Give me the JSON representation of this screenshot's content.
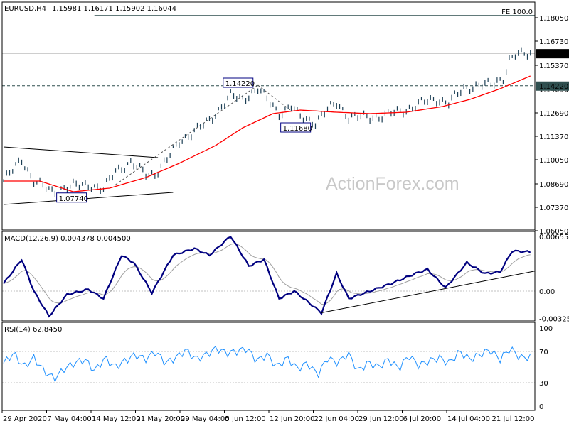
{
  "chart_data": {
    "type": "line",
    "title": "EURUSD,H4",
    "ohlc_header": "1.15981 1.16171 1.15902 1.16044",
    "watermark": "ActionForex.com",
    "price_panel": {
      "ylim": [
        1.0605,
        1.1905
      ],
      "ticks": [
        "1.18050",
        "1.16730",
        "1.15370",
        "1.14030",
        "1.12690",
        "1.11370",
        "1.10050",
        "1.08690",
        "1.07370",
        "1.06050"
      ],
      "tick_values": [
        1.1805,
        1.1673,
        1.1537,
        1.1403,
        1.1269,
        1.1137,
        1.1005,
        1.0869,
        1.0737,
        1.0605
      ],
      "bar_count": 175,
      "typical_bar_range": 0.003,
      "close_keypoints": [
        [
          0,
          1.0885
        ],
        [
          6,
          1.1005
        ],
        [
          10,
          1.0885
        ],
        [
          16,
          1.0825
        ],
        [
          23,
          1.0857
        ],
        [
          28,
          1.0865
        ],
        [
          33,
          1.0833
        ],
        [
          37,
          1.0945
        ],
        [
          42,
          1.0985
        ],
        [
          47,
          1.0925
        ],
        [
          50,
          1.0925
        ],
        [
          54,
          1.1005
        ],
        [
          58,
          1.1105
        ],
        [
          63,
          1.1165
        ],
        [
          68,
          1.1225
        ],
        [
          71,
          1.1285
        ],
        [
          75,
          1.1365
        ],
        [
          79,
          1.1345
        ],
        [
          84,
          1.1405
        ],
        [
          88,
          1.1325
        ],
        [
          91,
          1.1265
        ],
        [
          95,
          1.1305
        ],
        [
          98,
          1.1245
        ],
        [
          103,
          1.1215
        ],
        [
          107,
          1.1285
        ],
        [
          110,
          1.1325
        ],
        [
          114,
          1.1245
        ],
        [
          119,
          1.1245
        ],
        [
          124,
          1.1245
        ],
        [
          128,
          1.1265
        ],
        [
          133,
          1.1285
        ],
        [
          138,
          1.1325
        ],
        [
          143,
          1.1345
        ],
        [
          147,
          1.1325
        ],
        [
          152,
          1.1405
        ],
        [
          157,
          1.1425
        ],
        [
          161,
          1.1425
        ],
        [
          165,
          1.1465
        ],
        [
          167,
          1.1565
        ],
        [
          169,
          1.1593
        ],
        [
          174,
          1.1604
        ]
      ],
      "ma_keypoints": [
        [
          0,
          1.0885
        ],
        [
          12,
          1.0885
        ],
        [
          23,
          1.0825
        ],
        [
          35,
          1.0845
        ],
        [
          47,
          1.0905
        ],
        [
          58,
          1.0985
        ],
        [
          70,
          1.1085
        ],
        [
          79,
          1.1185
        ],
        [
          89,
          1.1265
        ],
        [
          98,
          1.1285
        ],
        [
          110,
          1.1273
        ],
        [
          121,
          1.1265
        ],
        [
          133,
          1.1273
        ],
        [
          145,
          1.1305
        ],
        [
          154,
          1.1345
        ],
        [
          164,
          1.1405
        ],
        [
          174,
          1.1477
        ]
      ],
      "current_price": {
        "value": 1.16044,
        "label": "1.16044"
      },
      "horizontal_line": {
        "value": 1.1422,
        "label": "1.14220",
        "style": "dashed"
      },
      "fe_line": {
        "value": 1.1818,
        "label": "FE 100.0",
        "from_bar": 30
      },
      "annotations": [
        {
          "label": "1.14220",
          "bar": 73,
          "value": 1.1437
        },
        {
          "label": "1.11680",
          "bar": 92,
          "value": 1.1185
        },
        {
          "label": "1.07740",
          "bar": 18,
          "value": 1.079
        }
      ],
      "trendlines": [
        {
          "name": "triangle-upper",
          "from": [
            0,
            1.1077
          ],
          "to": [
            51,
            1.1017
          ]
        },
        {
          "name": "triangle-lower",
          "from": [
            0,
            1.0753
          ],
          "to": [
            56,
            1.0821
          ]
        },
        {
          "name": "channel-dashed-1",
          "from": [
            37,
            1.0865
          ],
          "to": [
            84,
            1.1425
          ],
          "style": "dashed"
        },
        {
          "name": "channel-dashed-2",
          "from": [
            84,
            1.1425
          ],
          "to": [
            95,
            1.1281
          ],
          "style": "dashed"
        }
      ],
      "colors": {
        "bars": "#1c3f55",
        "ma": "#ff0000"
      }
    },
    "macd_panel": {
      "label": "MACD(12,26,9) 0.004378 0.004500",
      "ylim": [
        -0.0036,
        0.0067
      ],
      "ticks": [
        "0.006554",
        "0.00",
        "-0.003259"
      ],
      "tick_values": [
        0.006554,
        0,
        -0.003259
      ],
      "macd_keypoints": [
        [
          0,
          0.0009
        ],
        [
          6,
          0.0038
        ],
        [
          10,
          0
        ],
        [
          15,
          -0.003
        ],
        [
          21,
          -0.0004
        ],
        [
          28,
          0.0002
        ],
        [
          33,
          -0.0009
        ],
        [
          39,
          0.0043
        ],
        [
          43,
          0.0034
        ],
        [
          49,
          -0.0002
        ],
        [
          56,
          0.0043
        ],
        [
          63,
          0.0051
        ],
        [
          68,
          0.0043
        ],
        [
          75,
          0.0066
        ],
        [
          81,
          0.003
        ],
        [
          86,
          0.0038
        ],
        [
          91,
          -0.0009
        ],
        [
          96,
          0
        ],
        [
          105,
          -0.0026
        ],
        [
          110,
          0.0021
        ],
        [
          114,
          -0.0009
        ],
        [
          121,
          0
        ],
        [
          128,
          0.0009
        ],
        [
          136,
          0.0021
        ],
        [
          140,
          0.0026
        ],
        [
          146,
          0.0004
        ],
        [
          153,
          0.0034
        ],
        [
          159,
          0.0021
        ],
        [
          164,
          0.0023
        ],
        [
          168,
          0.0048
        ],
        [
          174,
          0.0047
        ]
      ],
      "trendline": {
        "from": [
          105,
          -0.0026
        ],
        "to": [
          175,
          0.0024
        ]
      },
      "colors": {
        "macd": "#000080",
        "signal": "#a0a0a0"
      }
    },
    "rsi_panel": {
      "label": "RSI(14) 62.8450",
      "ylim": [
        -3,
        103
      ],
      "ticks": [
        "100",
        "70",
        "30",
        "0"
      ],
      "tick_values": [
        100,
        70,
        30,
        0
      ],
      "values": [
        55,
        68,
        50,
        62,
        45,
        35,
        48,
        55,
        60,
        45,
        62,
        50,
        58,
        66,
        60,
        70,
        55,
        62,
        72,
        60,
        66,
        74,
        68,
        70,
        74,
        58,
        66,
        50,
        62,
        48,
        55,
        40,
        62,
        55,
        68,
        45,
        56,
        50,
        60,
        48,
        65,
        52,
        58,
        62,
        55,
        70,
        60,
        66,
        72,
        60,
        74,
        62,
        63
      ],
      "color": "#1e90ff"
    },
    "x_ticks": [
      "29 Apr 2020",
      "7 May 04:00",
      "14 May 12:00",
      "21 May 20:00",
      "29 May 04:00",
      "5 Jun 12:00",
      "12 Jun 20:00",
      "22 Jun 04:00",
      "29 Jun 12:00",
      "6 Jul 20:00",
      "14 Jul 04:00",
      "21 Jul 12:00"
    ]
  }
}
